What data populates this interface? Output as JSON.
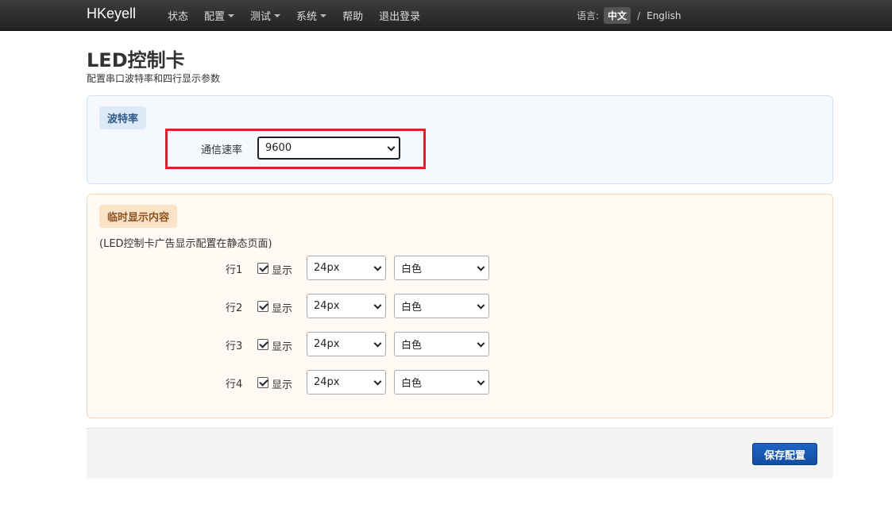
{
  "navbar": {
    "brand": "HKeyell",
    "items": [
      {
        "label": "状态",
        "dropdown": false
      },
      {
        "label": "配置",
        "dropdown": true
      },
      {
        "label": "测试",
        "dropdown": true
      },
      {
        "label": "系统",
        "dropdown": true
      },
      {
        "label": "帮助",
        "dropdown": false
      },
      {
        "label": "退出登录",
        "dropdown": false
      }
    ],
    "language_label": "语言:",
    "language_current": "中文",
    "language_separator": "/",
    "language_other": "English"
  },
  "page": {
    "title": "LED控制卡",
    "description": "配置串口波特率和四行显示参数"
  },
  "baud_section": {
    "legend": "波特率",
    "label": "通信速率",
    "value": "9600"
  },
  "display_section": {
    "legend": "临时显示内容",
    "note": "(LED控制卡广告显示配置在静态页面)",
    "rows": [
      {
        "label": "行1",
        "show_label": "显示",
        "checked": true,
        "size": "24px",
        "color": "白色"
      },
      {
        "label": "行2",
        "show_label": "显示",
        "checked": true,
        "size": "24px",
        "color": "白色"
      },
      {
        "label": "行3",
        "show_label": "显示",
        "checked": true,
        "size": "24px",
        "color": "白色"
      },
      {
        "label": "行4",
        "show_label": "显示",
        "checked": true,
        "size": "24px",
        "color": "白色"
      }
    ]
  },
  "footer": {
    "save_label": "保存配置"
  },
  "colors": {
    "highlight": "#d9232d",
    "primary_button": "#1e63c4"
  }
}
